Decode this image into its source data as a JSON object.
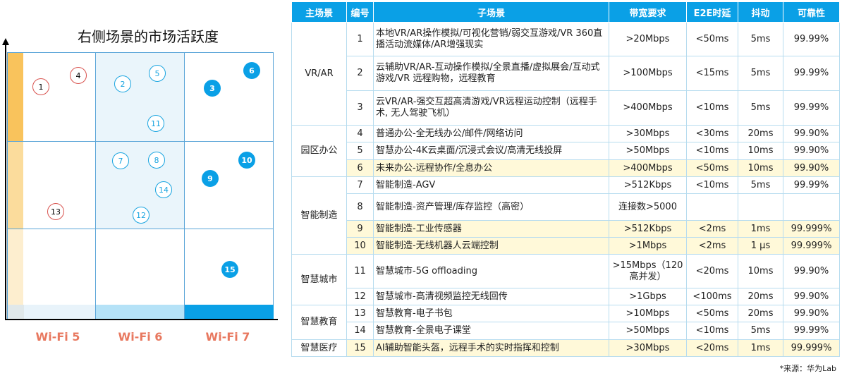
{
  "chart": {
    "title": "右侧场景的市场活跃度",
    "x_labels": [
      "Wi-Fi 5",
      "Wi-Fi 6",
      "Wi-Fi 7"
    ],
    "bubbles": [
      {
        "id": "1",
        "col": "Wi-Fi 5",
        "style": "outline-red"
      },
      {
        "id": "4",
        "col": "Wi-Fi 5",
        "style": "outline-red"
      },
      {
        "id": "13",
        "col": "Wi-Fi 5",
        "style": "outline-red"
      },
      {
        "id": "2",
        "col": "Wi-Fi 6",
        "style": "outline-blue"
      },
      {
        "id": "5",
        "col": "Wi-Fi 6",
        "style": "outline-blue"
      },
      {
        "id": "11",
        "col": "Wi-Fi 6",
        "style": "outline-blue"
      },
      {
        "id": "7",
        "col": "Wi-Fi 6",
        "style": "outline-blue"
      },
      {
        "id": "8",
        "col": "Wi-Fi 6",
        "style": "outline-blue"
      },
      {
        "id": "14",
        "col": "Wi-Fi 6",
        "style": "outline-blue"
      },
      {
        "id": "12",
        "col": "Wi-Fi 6",
        "style": "outline-blue"
      },
      {
        "id": "6",
        "col": "Wi-Fi 7",
        "style": "filled-blue"
      },
      {
        "id": "3",
        "col": "Wi-Fi 7",
        "style": "filled-blue"
      },
      {
        "id": "10",
        "col": "Wi-Fi 7",
        "style": "filled-blue"
      },
      {
        "id": "9",
        "col": "Wi-Fi 7",
        "style": "filled-blue"
      },
      {
        "id": "15",
        "col": "Wi-Fi 7",
        "style": "filled-blue"
      }
    ],
    "colors": {
      "accent_blue": "#0aa0e6",
      "red_outline": "#d9534f",
      "orange": "#f9c35c",
      "label_color": "#e8785f"
    }
  },
  "table": {
    "headers": [
      "主场景",
      "编号",
      "子场景",
      "带宽要求",
      "E2E时延",
      "抖动",
      "可靠性"
    ],
    "groups": [
      {
        "name": "VR/AR",
        "rows": [
          {
            "no": "1",
            "sub": "本地VR/AR操作模拟/可视化营销/弱交互游戏/VR 360直播活动流媒体/AR增强现实",
            "bw": ">20Mbps",
            "e2e": "<50ms",
            "jitter": "5ms",
            "rel": "99.99%",
            "hl": false
          },
          {
            "no": "2",
            "sub": "云辅助VR/AR-互动操作模拟/全景直播/虚拟展会/互动式游戏/VR 远程购物，远程教育",
            "bw": ">100Mbps",
            "e2e": "<15ms",
            "jitter": "5ms",
            "rel": "99.99%",
            "hl": false
          },
          {
            "no": "3",
            "sub": "云VR/AR-强交互超高清游戏/VR远程运动控制（远程手术, 无人驾驶飞机）",
            "bw": ">400Mbps",
            "e2e": "<10ms",
            "jitter": "5ms",
            "rel": "99.99%",
            "hl": false
          }
        ]
      },
      {
        "name": "园区办公",
        "rows": [
          {
            "no": "4",
            "sub": "普通办公-全无线办公/邮件/网络访问",
            "bw": ">30Mbps",
            "e2e": "<30ms",
            "jitter": "20ms",
            "rel": "99.90%",
            "hl": false
          },
          {
            "no": "5",
            "sub": "智慧办公-4K云桌面/沉浸式会议/高清无线投屏",
            "bw": ">50Mbps",
            "e2e": "<10ms",
            "jitter": "10ms",
            "rel": "99.90%",
            "hl": false
          },
          {
            "no": "6",
            "sub": "未来办公-远程协作/全息办公",
            "bw": ">400Mbps",
            "e2e": "<50ms",
            "jitter": "10ms",
            "rel": "99.90%",
            "hl": true
          }
        ]
      },
      {
        "name": "智能制造",
        "rows": [
          {
            "no": "7",
            "sub": "智能制造-AGV",
            "bw": ">512Kbps",
            "e2e": "<10ms",
            "jitter": "5ms",
            "rel": "99.99%",
            "hl": false
          },
          {
            "no": "8",
            "sub": "智能制造-资产管理/库存监控（高密）",
            "bw": "连接数>5000",
            "e2e": "",
            "jitter": "",
            "rel": "",
            "hl": false
          },
          {
            "no": "9",
            "sub": "智能制造-工业传感器",
            "bw": ">512Kbps",
            "e2e": "<2ms",
            "jitter": "1ms",
            "rel": "99.999%",
            "hl": true
          },
          {
            "no": "10",
            "sub": "智能制造-无线机器人云端控制",
            "bw": ">1Mbps",
            "e2e": "<2ms",
            "jitter": "1 μs",
            "rel": "99.999%",
            "hl": true
          }
        ]
      },
      {
        "name": "智慧城市",
        "rows": [
          {
            "no": "11",
            "sub": "智慧城市-5G offloading",
            "bw": ">15Mbps（120高并发）",
            "e2e": "<20ms",
            "jitter": "10ms",
            "rel": "99.90%",
            "hl": false
          },
          {
            "no": "12",
            "sub": "智慧城市-高清视频监控无线回传",
            "bw": ">1Gbps",
            "e2e": "<100ms",
            "jitter": "20ms",
            "rel": "99.90%",
            "hl": false
          }
        ]
      },
      {
        "name": "智慧教育",
        "rows": [
          {
            "no": "13",
            "sub": "智慧教育-电子书包",
            "bw": ">10Mbps",
            "e2e": "<50ms",
            "jitter": "20ms",
            "rel": "99.90%",
            "hl": false
          },
          {
            "no": "14",
            "sub": "智慧教育-全景电子课堂",
            "bw": ">50Mbps",
            "e2e": "<10ms",
            "jitter": "5ms",
            "rel": "99.99%",
            "hl": false
          }
        ]
      },
      {
        "name": "智慧医疗",
        "rows": [
          {
            "no": "15",
            "sub": "AI辅助智能头盔，远程手术的实时指挥和控制",
            "bw": ">30Mbps",
            "e2e": "<20ms",
            "jitter": "1ms",
            "rel": "99.999%",
            "hl": true
          }
        ]
      }
    ]
  },
  "source": "*来源：华为Lab"
}
